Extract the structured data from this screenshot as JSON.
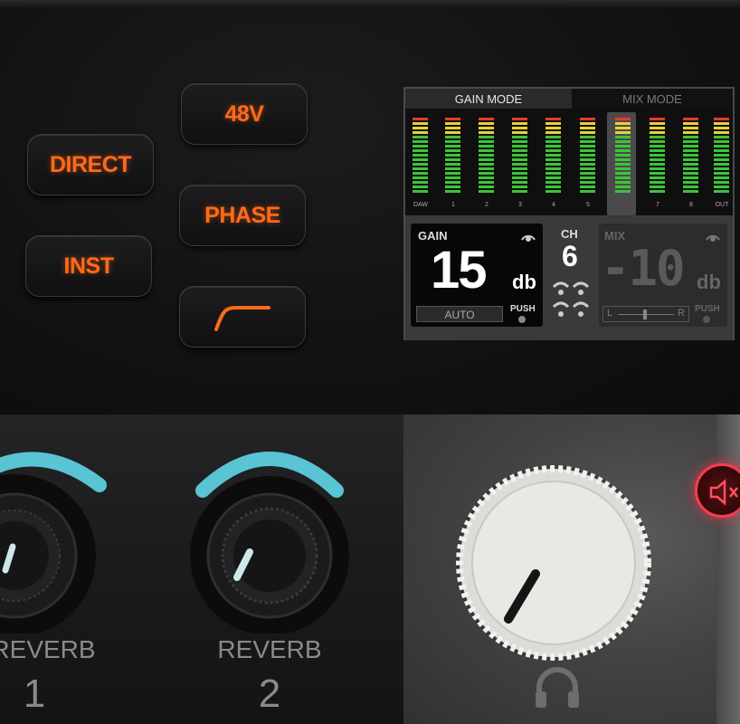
{
  "buttons": {
    "direct": "DIRECT",
    "inst": "INST",
    "v48": "48V",
    "phase": "PHASE"
  },
  "screen": {
    "tabs": [
      "GAIN MODE",
      "MIX MODE"
    ],
    "active_tab": "GAIN MODE",
    "meter_labels": [
      "DAW",
      "1",
      "2",
      "3",
      "4",
      "5",
      "6",
      "7",
      "8",
      "OUT"
    ],
    "selected_channel": "6",
    "gain": {
      "label": "GAIN",
      "value": "15",
      "unit": "db",
      "auto_label": "AUTO",
      "push_label": "PUSH"
    },
    "channel": {
      "label": "CH",
      "value": "6"
    },
    "mix": {
      "label": "MIX",
      "value": "-10",
      "unit": "db",
      "pan_left": "L",
      "pan_right": "R",
      "push_label": "PUSH"
    }
  },
  "knobs": {
    "reverb1": {
      "label": "REVERB",
      "number": "1"
    },
    "reverb2": {
      "label": "REVERB",
      "number": "2"
    }
  },
  "colors": {
    "button_text": "#ff6a1a",
    "ring_glow": "#5fd6e8",
    "mute_red": "#ff3b4a",
    "meter_green": "#3ec43a",
    "meter_yellow": "#e6d23a",
    "meter_red": "#e83a2a"
  },
  "icons": {
    "hpf": "high-pass-filter-icon",
    "mute": "speaker-mute-icon",
    "headphones": "headphones-icon"
  }
}
